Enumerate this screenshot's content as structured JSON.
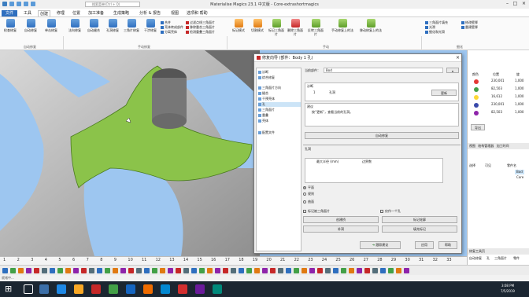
{
  "app": {
    "title": "Materialise Magics 23.1 中文版 - Core-extrashortmagics",
    "menus": [
      "文件",
      "工具",
      "创建",
      "修理",
      "位置",
      "加工准备",
      "生成策略",
      "分析 & 报告",
      "视图",
      "选项和 帮助"
    ],
    "search_placeholder": "搜索菜单(Ctrl + Q)"
  },
  "ribbon": {
    "auto_fix": [
      "检查修复",
      "自动修复",
      "单击修复"
    ],
    "auto_fix_group": "自动修复",
    "manual": [
      "法向修复",
      "自动缝合",
      "孔洞修复",
      "三角片修复",
      "干涉修复"
    ],
    "manual_small": [
      "合并",
      "壳体转成部件",
      "分离壳体"
    ],
    "manual_small2": [
      "过滤点线三角面片",
      "移除重合三角面片",
      "检测重叠三角面片"
    ],
    "manual_group": "手动修复",
    "extra": [
      "标记模式",
      "切割模式",
      "标记三角面片",
      "删除三角面片",
      "反转三角面片",
      "手动修复上的法",
      "移动修复上的法"
    ],
    "extra_group": "手动",
    "right_small": [
      "三角面片填充",
      "光滑",
      "细化和光滑"
    ],
    "right_small2": [
      "修改壁厚",
      "重建壁厚"
    ],
    "right_group": "细化"
  },
  "ruler": [
    "1",
    "2",
    "3",
    "4",
    "5",
    "6",
    "7",
    "8",
    "9",
    "10",
    "11",
    "12",
    "13",
    "14",
    "15",
    "16",
    "17",
    "18",
    "19",
    "20",
    "21",
    "22",
    "23",
    "24",
    "25",
    "26",
    "27",
    "28",
    "29",
    "30",
    "31",
    "32",
    "33"
  ],
  "dialog": {
    "title": "修复向导 (部件：Body 1 孔)",
    "nav": [
      "诊断",
      "综合修复",
      "三角面片方向",
      "缝合",
      "干预壳体",
      "孔",
      "三角面片",
      "重叠",
      "壳体",
      "配置文件"
    ],
    "current_part_label": "当前部件：",
    "current_part": "Bod",
    "diag_label": "诊断",
    "diag_count": "1",
    "diag_item": "孔洞",
    "update_btn": "更新",
    "advice_label": "建议",
    "advice_text": "按“更新”，查看当前的孔洞。",
    "auto_fix_btn": "自动修复",
    "tabs_label": "孔洞",
    "col1": "最大半径 (mm)",
    "col2": "边界数",
    "options": [
      "平面",
      "规则",
      "曲面"
    ],
    "check1": "标记被三角面片",
    "check2": "仅作一个孔",
    "btns": [
      "创建桥",
      "标记轮廓",
      "补洞",
      "填充标记"
    ],
    "bottom": [
      "跟踪建议",
      "应用",
      "帮助"
    ]
  },
  "right_panel": {
    "cols": [
      "颜色",
      "位置",
      "旋"
    ],
    "rows": [
      {
        "pos": "230,001",
        "val": "1,000",
        "color": "#e53935"
      },
      {
        "pos": "82,503",
        "val": "1,000",
        "color": "#43a047"
      },
      {
        "pos": "16,612",
        "val": "1,000",
        "color": "#fdd835"
      },
      {
        "pos": "230,001",
        "val": "1,000",
        "color": "#3949ab"
      },
      {
        "pos": "82,503",
        "val": "1,000",
        "color": "#8e24aa"
      }
    ],
    "export_label": "导出",
    "tabs": [
      "视图",
      "结构管理器",
      "加工时间"
    ],
    "part_header": [
      "选择",
      "可见",
      "零件名"
    ],
    "parts": [
      "Bod",
      "Core"
    ],
    "bottom_tabs": [
      "修复工具页",
      "自动修复",
      "三角面片",
      "孔",
      "三角面片",
      "壳体"
    ],
    "bottom_cols": [
      "壳体",
      "孔",
      "三角面片",
      "零件"
    ]
  },
  "status": "就绪中...",
  "clock": {
    "time": "3:08 PM",
    "date": "7/5/2019"
  }
}
